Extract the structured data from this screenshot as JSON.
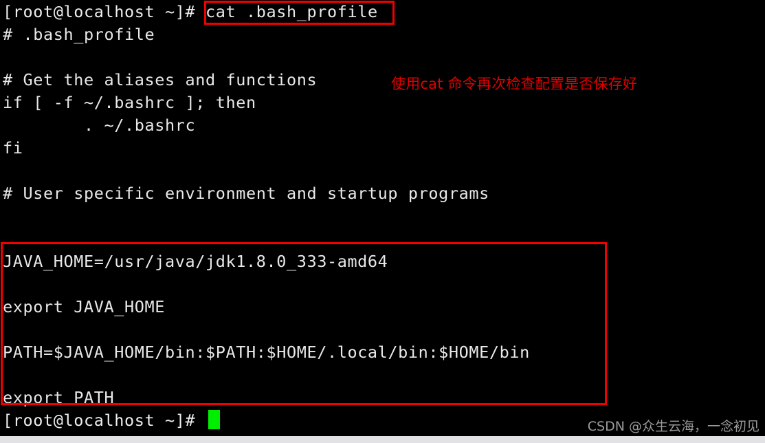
{
  "terminal": {
    "prompt": "[root@localhost ~]#",
    "command": "cat .bash_profile",
    "prompt_line_top": "[root@localhost ~]# ",
    "prompt_line_bottom": "[root@localhost ~]# ",
    "output_lines": [
      "# .bash_profile",
      "",
      "# Get the aliases and functions",
      "if [ -f ~/.bashrc ]; then",
      "        . ~/.bashrc",
      "fi",
      "",
      "# User specific environment and startup programs",
      "",
      "JAVA_HOME=/usr/java/jdk1.8.0_333-amd64",
      "",
      "export JAVA_HOME",
      "",
      "PATH=$JAVA_HOME/bin:$PATH:$HOME/.local/bin:$HOME/bin",
      "",
      "export PATH"
    ],
    "line_comment_bash_profile": "# .bash_profile",
    "line_comment_aliases": "# Get the aliases and functions",
    "line_if": "if [ -f ~/.bashrc ]; then",
    "line_source": "        . ~/.bashrc",
    "line_fi": "fi",
    "line_comment_user": "# User specific environment and startup programs",
    "line_java_home": "JAVA_HOME=/usr/java/jdk1.8.0_333-amd64",
    "line_export_java_home": "export JAVA_HOME",
    "line_path": "PATH=$JAVA_HOME/bin:$PATH:$HOME/.local/bin:$HOME/bin",
    "line_export_path": "export PATH",
    "cursor": "block-cursor"
  },
  "annotations": {
    "note_text": "使用cat 命令再次检查配置是否保存好",
    "note_color": "#e00000",
    "highlight_box_command": "cat .bash_profile",
    "highlight_box_env": "JAVA_HOME / PATH export block",
    "box_color": "#f00000"
  },
  "watermark": {
    "text": "CSDN @众生云海，一念初见",
    "color": "#9b9b9b"
  },
  "colors": {
    "background": "#000000",
    "foreground": "#e8e8e8",
    "cursor": "#00ef00",
    "annotation_red": "#e00000",
    "bottom_strip": "#e2e2e4"
  }
}
